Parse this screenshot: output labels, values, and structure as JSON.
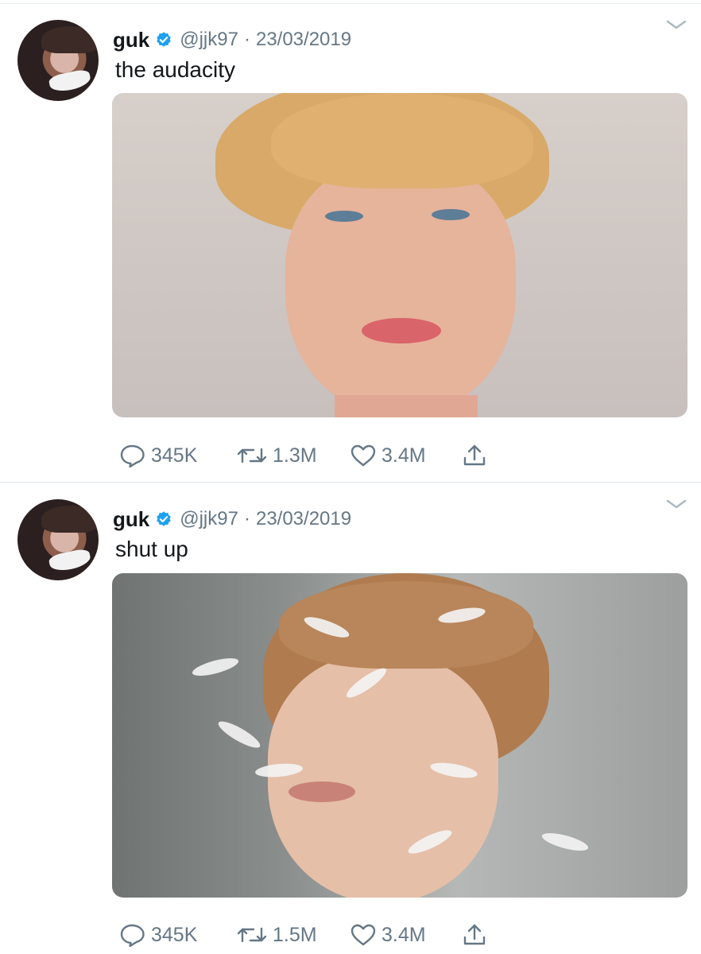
{
  "tweets": [
    {
      "author_name": "guk",
      "handle": "@jjk97",
      "separator": "·",
      "date": "23/03/2019",
      "text": "the audacity",
      "stats": {
        "replies": "345K",
        "retweets": "1.3M",
        "likes": "3.4M"
      }
    },
    {
      "author_name": "guk",
      "handle": "@jjk97",
      "separator": "·",
      "date": "23/03/2019",
      "text": "shut up",
      "stats": {
        "replies": "345K",
        "retweets": "1.5M",
        "likes": "3.4M"
      }
    }
  ],
  "icons": {
    "verified": "verified-badge-icon",
    "caret": "chevron-down-icon",
    "reply": "reply-bubble-icon",
    "retweet": "retweet-icon",
    "like": "heart-icon",
    "share": "share-upload-icon"
  },
  "colors": {
    "verified_blue": "#1da1f2",
    "secondary_text": "#657786",
    "primary_text": "#14171a",
    "divider": "#e1e8ed"
  }
}
